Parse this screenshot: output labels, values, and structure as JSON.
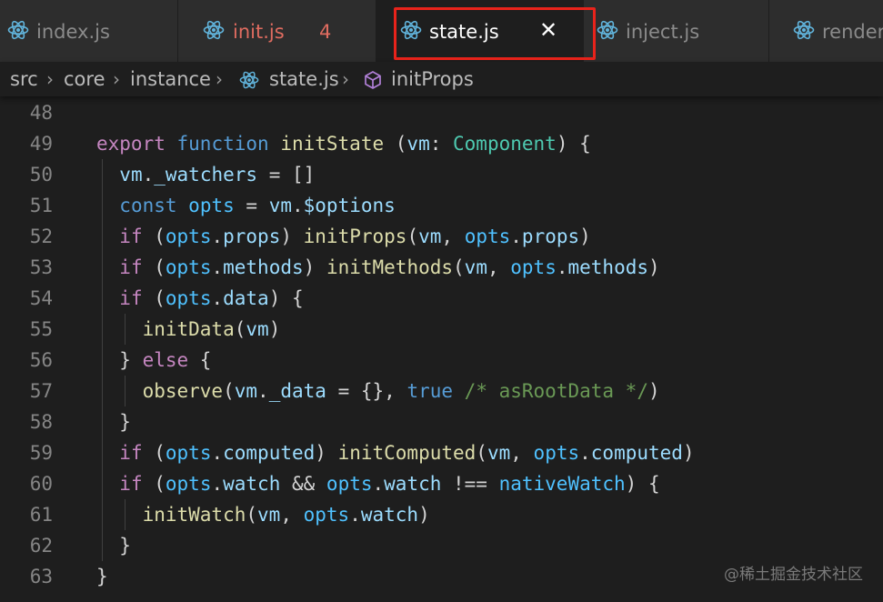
{
  "tabs": [
    {
      "label": "index.js",
      "count": "",
      "active": false,
      "modified": false
    },
    {
      "label": "init.js",
      "count": "4",
      "active": false,
      "modified": true
    },
    {
      "label": "state.js",
      "count": "",
      "active": true,
      "modified": false
    },
    {
      "label": "inject.js",
      "count": "",
      "active": false,
      "modified": false
    },
    {
      "label": "render",
      "count": "",
      "active": false,
      "modified": false
    }
  ],
  "close_glyph": "✕",
  "breadcrumb": {
    "items": [
      "src",
      "core",
      "instance",
      "state.js",
      "initProps"
    ],
    "separator": "›"
  },
  "colors": {
    "keyword": "#569cd6",
    "control": "#c586c0",
    "function": "#dcdcaa",
    "variable": "#9cdcfe",
    "const": "#4fc1ff",
    "type": "#4ec9b0",
    "comment": "#6a9955",
    "punct": "#d4d4d4",
    "react_icon": "#61b4dc",
    "symbol_icon": "#b180d7"
  },
  "editor": {
    "lines": [
      {
        "num": "48",
        "tokens": []
      },
      {
        "num": "49",
        "tokens": [
          {
            "t": "export",
            "c": "control"
          },
          {
            "t": " ",
            "c": "punct"
          },
          {
            "t": "function",
            "c": "keyword"
          },
          {
            "t": " ",
            "c": "punct"
          },
          {
            "t": "initState",
            "c": "function"
          },
          {
            "t": " (",
            "c": "punct"
          },
          {
            "t": "vm",
            "c": "variable"
          },
          {
            "t": ": ",
            "c": "punct"
          },
          {
            "t": "Component",
            "c": "type"
          },
          {
            "t": ") {",
            "c": "punct"
          }
        ]
      },
      {
        "num": "50",
        "tokens": [
          {
            "t": "  ",
            "c": "punct"
          },
          {
            "t": "vm",
            "c": "variable"
          },
          {
            "t": ".",
            "c": "punct"
          },
          {
            "t": "_watchers",
            "c": "variable"
          },
          {
            "t": " = []",
            "c": "punct"
          }
        ]
      },
      {
        "num": "51",
        "tokens": [
          {
            "t": "  ",
            "c": "punct"
          },
          {
            "t": "const",
            "c": "keyword"
          },
          {
            "t": " ",
            "c": "punct"
          },
          {
            "t": "opts",
            "c": "const"
          },
          {
            "t": " = ",
            "c": "punct"
          },
          {
            "t": "vm",
            "c": "variable"
          },
          {
            "t": ".",
            "c": "punct"
          },
          {
            "t": "$options",
            "c": "variable"
          }
        ]
      },
      {
        "num": "52",
        "tokens": [
          {
            "t": "  ",
            "c": "punct"
          },
          {
            "t": "if",
            "c": "control"
          },
          {
            "t": " (",
            "c": "punct"
          },
          {
            "t": "opts",
            "c": "const"
          },
          {
            "t": ".",
            "c": "punct"
          },
          {
            "t": "props",
            "c": "variable"
          },
          {
            "t": ") ",
            "c": "punct"
          },
          {
            "t": "initProps",
            "c": "function"
          },
          {
            "t": "(",
            "c": "punct"
          },
          {
            "t": "vm",
            "c": "variable"
          },
          {
            "t": ", ",
            "c": "punct"
          },
          {
            "t": "opts",
            "c": "const"
          },
          {
            "t": ".",
            "c": "punct"
          },
          {
            "t": "props",
            "c": "variable"
          },
          {
            "t": ")",
            "c": "punct"
          }
        ]
      },
      {
        "num": "53",
        "tokens": [
          {
            "t": "  ",
            "c": "punct"
          },
          {
            "t": "if",
            "c": "control"
          },
          {
            "t": " (",
            "c": "punct"
          },
          {
            "t": "opts",
            "c": "const"
          },
          {
            "t": ".",
            "c": "punct"
          },
          {
            "t": "methods",
            "c": "variable"
          },
          {
            "t": ") ",
            "c": "punct"
          },
          {
            "t": "initMethods",
            "c": "function"
          },
          {
            "t": "(",
            "c": "punct"
          },
          {
            "t": "vm",
            "c": "variable"
          },
          {
            "t": ", ",
            "c": "punct"
          },
          {
            "t": "opts",
            "c": "const"
          },
          {
            "t": ".",
            "c": "punct"
          },
          {
            "t": "methods",
            "c": "variable"
          },
          {
            "t": ")",
            "c": "punct"
          }
        ]
      },
      {
        "num": "54",
        "tokens": [
          {
            "t": "  ",
            "c": "punct"
          },
          {
            "t": "if",
            "c": "control"
          },
          {
            "t": " (",
            "c": "punct"
          },
          {
            "t": "opts",
            "c": "const"
          },
          {
            "t": ".",
            "c": "punct"
          },
          {
            "t": "data",
            "c": "variable"
          },
          {
            "t": ") {",
            "c": "punct"
          }
        ]
      },
      {
        "num": "55",
        "tokens": [
          {
            "t": "    ",
            "c": "punct"
          },
          {
            "t": "initData",
            "c": "function"
          },
          {
            "t": "(",
            "c": "punct"
          },
          {
            "t": "vm",
            "c": "variable"
          },
          {
            "t": ")",
            "c": "punct"
          }
        ]
      },
      {
        "num": "56",
        "tokens": [
          {
            "t": "  } ",
            "c": "punct"
          },
          {
            "t": "else",
            "c": "control"
          },
          {
            "t": " {",
            "c": "punct"
          }
        ]
      },
      {
        "num": "57",
        "tokens": [
          {
            "t": "    ",
            "c": "punct"
          },
          {
            "t": "observe",
            "c": "function"
          },
          {
            "t": "(",
            "c": "punct"
          },
          {
            "t": "vm",
            "c": "variable"
          },
          {
            "t": ".",
            "c": "punct"
          },
          {
            "t": "_data",
            "c": "variable"
          },
          {
            "t": " = {}, ",
            "c": "punct"
          },
          {
            "t": "true",
            "c": "keyword"
          },
          {
            "t": " ",
            "c": "punct"
          },
          {
            "t": "/* asRootData */",
            "c": "comment"
          },
          {
            "t": ")",
            "c": "punct"
          }
        ]
      },
      {
        "num": "58",
        "tokens": [
          {
            "t": "  }",
            "c": "punct"
          }
        ]
      },
      {
        "num": "59",
        "tokens": [
          {
            "t": "  ",
            "c": "punct"
          },
          {
            "t": "if",
            "c": "control"
          },
          {
            "t": " (",
            "c": "punct"
          },
          {
            "t": "opts",
            "c": "const"
          },
          {
            "t": ".",
            "c": "punct"
          },
          {
            "t": "computed",
            "c": "variable"
          },
          {
            "t": ") ",
            "c": "punct"
          },
          {
            "t": "initComputed",
            "c": "function"
          },
          {
            "t": "(",
            "c": "punct"
          },
          {
            "t": "vm",
            "c": "variable"
          },
          {
            "t": ", ",
            "c": "punct"
          },
          {
            "t": "opts",
            "c": "const"
          },
          {
            "t": ".",
            "c": "punct"
          },
          {
            "t": "computed",
            "c": "variable"
          },
          {
            "t": ")",
            "c": "punct"
          }
        ]
      },
      {
        "num": "60",
        "tokens": [
          {
            "t": "  ",
            "c": "punct"
          },
          {
            "t": "if",
            "c": "control"
          },
          {
            "t": " (",
            "c": "punct"
          },
          {
            "t": "opts",
            "c": "const"
          },
          {
            "t": ".",
            "c": "punct"
          },
          {
            "t": "watch",
            "c": "variable"
          },
          {
            "t": " && ",
            "c": "punct"
          },
          {
            "t": "opts",
            "c": "const"
          },
          {
            "t": ".",
            "c": "punct"
          },
          {
            "t": "watch",
            "c": "variable"
          },
          {
            "t": " !== ",
            "c": "punct"
          },
          {
            "t": "nativeWatch",
            "c": "const"
          },
          {
            "t": ") {",
            "c": "punct"
          }
        ]
      },
      {
        "num": "61",
        "tokens": [
          {
            "t": "    ",
            "c": "punct"
          },
          {
            "t": "initWatch",
            "c": "function"
          },
          {
            "t": "(",
            "c": "punct"
          },
          {
            "t": "vm",
            "c": "variable"
          },
          {
            "t": ", ",
            "c": "punct"
          },
          {
            "t": "opts",
            "c": "const"
          },
          {
            "t": ".",
            "c": "punct"
          },
          {
            "t": "watch",
            "c": "variable"
          },
          {
            "t": ")",
            "c": "punct"
          }
        ]
      },
      {
        "num": "62",
        "tokens": [
          {
            "t": "  }",
            "c": "punct"
          }
        ]
      },
      {
        "num": "63",
        "tokens": [
          {
            "t": "}",
            "c": "punct"
          }
        ]
      }
    ]
  },
  "watermark": "@稀土掘金技术社区"
}
